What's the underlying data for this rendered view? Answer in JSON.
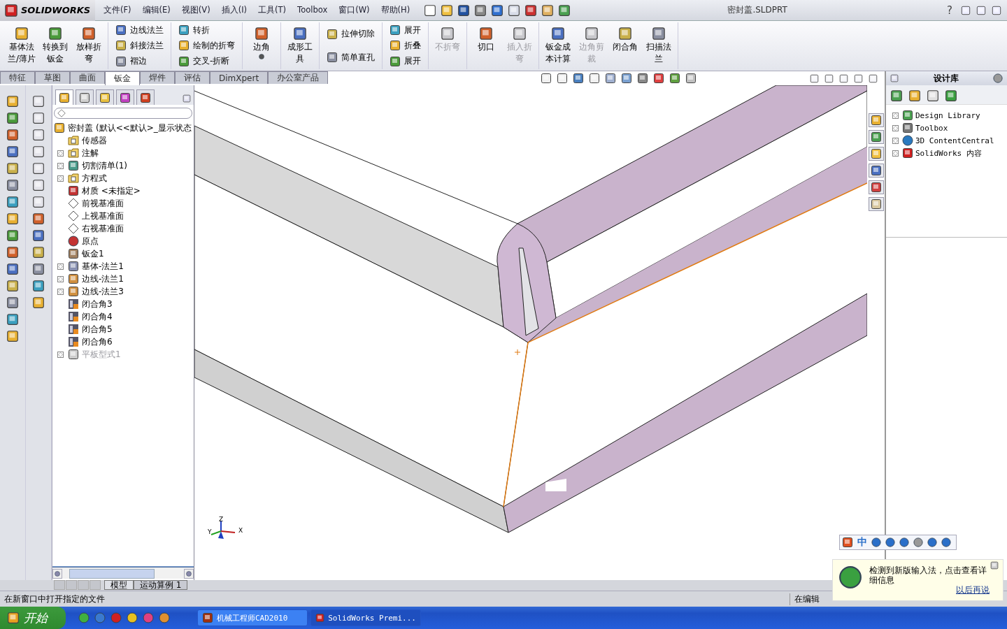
{
  "title_bar": {
    "logo": "SOLIDWORKS",
    "menus": [
      "文件(F)",
      "编辑(E)",
      "视图(V)",
      "插入(I)",
      "工具(T)",
      "Toolbox",
      "窗口(W)",
      "帮助(H)"
    ],
    "title": "密封盖.SLDPRT",
    "help": "?"
  },
  "ribbon": {
    "groups": [
      {
        "kind": "large",
        "items": [
          {
            "label": "基体法兰/薄片",
            "disabled": false
          },
          {
            "label": "转换到钣金",
            "disabled": false
          },
          {
            "label": "放样折弯",
            "disabled": false
          }
        ]
      },
      {
        "kind": "column",
        "items": [
          {
            "label": "边线法兰",
            "disabled": false
          },
          {
            "label": "斜接法兰",
            "disabled": false
          },
          {
            "label": "褶边",
            "disabled": false
          }
        ]
      },
      {
        "kind": "column",
        "items": [
          {
            "label": "转折",
            "disabled": false
          },
          {
            "label": "绘制的折弯",
            "disabled": false
          },
          {
            "label": "交叉-折断",
            "disabled": false
          }
        ]
      },
      {
        "kind": "large-menu",
        "items": [
          {
            "label": "边角",
            "disabled": false
          }
        ]
      },
      {
        "kind": "large",
        "items": [
          {
            "label": "成形工具",
            "disabled": false
          }
        ]
      },
      {
        "kind": "column",
        "items": [
          {
            "label": "拉伸切除",
            "disabled": false
          },
          {
            "label": "简单直孔",
            "disabled": false
          }
        ]
      },
      {
        "kind": "column",
        "items": [
          {
            "label": "展开",
            "disabled": false
          },
          {
            "label": "折叠",
            "disabled": false
          },
          {
            "label": "展开",
            "disabled": false
          }
        ]
      },
      {
        "kind": "large",
        "items": [
          {
            "label": "不折弯",
            "disabled": true
          }
        ]
      },
      {
        "kind": "large",
        "items": [
          {
            "label": "切口",
            "disabled": false
          },
          {
            "label": "插入折弯",
            "disabled": true
          }
        ]
      },
      {
        "kind": "large",
        "items": [
          {
            "label": "钣金成本计算",
            "disabled": false
          },
          {
            "label": "边角剪裁",
            "disabled": true
          },
          {
            "label": "闭合角",
            "disabled": false
          },
          {
            "label": "扫描法兰",
            "disabled": false
          }
        ]
      }
    ]
  },
  "command_tabs": [
    {
      "label": "特征",
      "selected": false
    },
    {
      "label": "草图",
      "selected": false
    },
    {
      "label": "曲面",
      "selected": false
    },
    {
      "label": "钣金",
      "selected": true
    },
    {
      "label": "焊件",
      "selected": false
    },
    {
      "label": "评估",
      "selected": false
    },
    {
      "label": "DimXpert",
      "selected": false
    },
    {
      "label": "办公室产品",
      "selected": false
    }
  ],
  "feature_tree": {
    "panel_tabs": [
      {
        "selected": true
      },
      {
        "selected": false
      },
      {
        "selected": false
      },
      {
        "selected": false
      },
      {
        "selected": false
      }
    ],
    "root": {
      "label": "密封盖",
      "config": "(默认<<默认>_显示状态"
    },
    "items": [
      {
        "label": "传感器",
        "kind": "sensor",
        "expandable": false,
        "disabled": false
      },
      {
        "label": "注解",
        "kind": "annotation",
        "expandable": true,
        "disabled": false
      },
      {
        "label": "切割清单(1)",
        "kind": "cutlist",
        "expandable": true,
        "disabled": false
      },
      {
        "label": "方程式",
        "kind": "equation",
        "expandable": true,
        "disabled": false
      },
      {
        "label": "材质 <未指定>",
        "kind": "material",
        "expandable": false,
        "disabled": false
      },
      {
        "label": "前视基准面",
        "kind": "plane",
        "expandable": false,
        "disabled": false
      },
      {
        "label": "上视基准面",
        "kind": "plane",
        "expandable": false,
        "disabled": false
      },
      {
        "label": "右视基准面",
        "kind": "plane",
        "expandable": false,
        "disabled": false
      },
      {
        "label": "原点",
        "kind": "origin",
        "expandable": false,
        "disabled": false
      },
      {
        "label": "钣金1",
        "kind": "sheetmetal",
        "expandable": false,
        "disabled": false
      },
      {
        "label": "基体-法兰1",
        "kind": "flange",
        "expandable": true,
        "disabled": false
      },
      {
        "label": "边线-法兰1",
        "kind": "edgeflange",
        "expandable": true,
        "disabled": false
      },
      {
        "label": "边线-法兰3",
        "kind": "edgeflange",
        "expandable": true,
        "disabled": false
      },
      {
        "label": "闭合角3",
        "kind": "corner",
        "expandable": false,
        "disabled": false
      },
      {
        "label": "闭合角4",
        "kind": "corner",
        "expandable": false,
        "disabled": false
      },
      {
        "label": "闭合角5",
        "kind": "corner",
        "expandable": false,
        "disabled": false
      },
      {
        "label": "闭合角6",
        "kind": "corner",
        "expandable": false,
        "disabled": false
      },
      {
        "label": "平板型式1",
        "kind": "flat",
        "expandable": true,
        "disabled": true
      }
    ]
  },
  "view_triad": [
    "Z",
    "Y",
    "X"
  ],
  "design_library": {
    "title": "设计库",
    "items": [
      {
        "label": "Design Library",
        "kind": "library"
      },
      {
        "label": "Toolbox",
        "kind": "toolbox"
      },
      {
        "label": "3D ContentCentral",
        "kind": "globe"
      },
      {
        "label": "SolidWorks 内容",
        "kind": "solidworks"
      }
    ]
  },
  "bottom_tabs": [
    {
      "label": "模型",
      "selected": true
    },
    {
      "label": "运动算例 1",
      "selected": false
    }
  ],
  "status_bar": {
    "message": "在新窗口中打开指定的文件",
    "edit_status": "在编辑"
  },
  "ime_bar": {
    "mode": "中"
  },
  "notification": {
    "message": "检测到新版输入法，点击查看详细信息",
    "link": "以后再说"
  },
  "taskbar": {
    "start": "开始",
    "windows": [
      {
        "label": "机械工程师CAD2010",
        "selected": false
      },
      {
        "label": "SolidWorks Premi...",
        "selected": true
      }
    ]
  }
}
